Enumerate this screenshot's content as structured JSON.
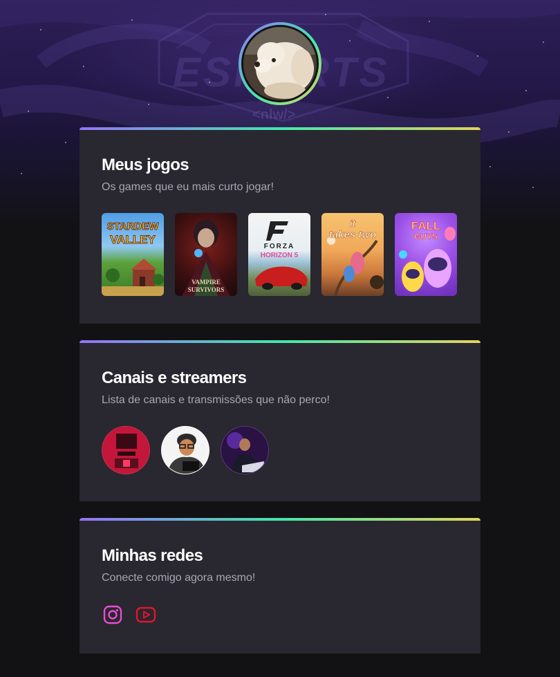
{
  "profile": {
    "avatar_icon": "dog-avatar-photo"
  },
  "games_section": {
    "title": "Meus jogos",
    "subtitle": "Os games que eu mais curto jogar!",
    "games": [
      {
        "name": "Stardew Valley",
        "line1": "STARDEW",
        "line2": "VALLEY"
      },
      {
        "name": "Vampire Survivors",
        "line1": "VAMPIRE",
        "line2": "SURVIVORS"
      },
      {
        "name": "Forza Horizon 5",
        "line1": "FORZA",
        "line2": "HORIZON 5"
      },
      {
        "name": "It Takes Two",
        "line1": "it",
        "line2": "takes two"
      },
      {
        "name": "Fall Guys",
        "line1": "FALL",
        "line2": "GUYS"
      }
    ]
  },
  "channels_section": {
    "title": "Canais e streamers",
    "subtitle": "Lista de canais e transmissões que não perco!",
    "streamers": [
      {
        "icon": "streamer-avatar-red"
      },
      {
        "icon": "streamer-avatar-cartoon"
      },
      {
        "icon": "streamer-avatar-purple"
      }
    ]
  },
  "social_section": {
    "title": "Minhas redes",
    "subtitle": "Conecte comigo agora mesmo!",
    "links": [
      {
        "icon": "instagram-icon",
        "color": "#ea4ed2"
      },
      {
        "icon": "youtube-icon",
        "color": "#e3152c"
      }
    ]
  },
  "colors": {
    "background": "#121214",
    "card": "#29272f",
    "gradient_start": "#9572fc",
    "gradient_mid": "#43e7ad",
    "gradient_end": "#e2d45c",
    "heading": "#ffffff",
    "subtitle": "#a8a8b3"
  }
}
